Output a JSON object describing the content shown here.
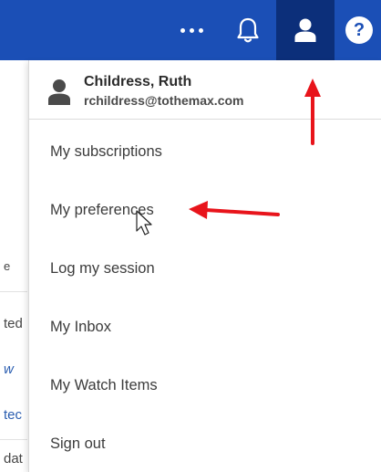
{
  "topbar": {
    "color": "#1b4fb6",
    "icons": [
      "more-icon",
      "bell-icon",
      "user-icon",
      "help-icon"
    ],
    "help_label": "?"
  },
  "background_page": {
    "fragments": [
      "e",
      "ted",
      "w",
      "tec",
      "dat"
    ]
  },
  "user_menu": {
    "name": "Childress, Ruth",
    "email": "rchildress@tothemax.com",
    "items": [
      "My subscriptions",
      "My preferences",
      "Log my session",
      "My Inbox",
      "My Watch Items",
      "Sign out"
    ]
  },
  "annotations": {
    "arrow_color": "#e8141b"
  }
}
